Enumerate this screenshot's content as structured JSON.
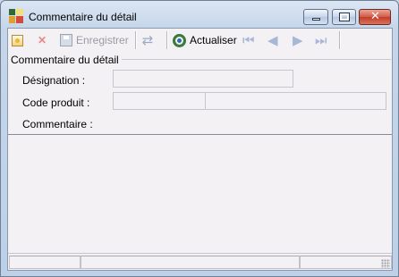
{
  "window": {
    "title": "Commentaire du détail",
    "app_icon": "app-grid-icon",
    "controls": {
      "minimize_icon": "minimize-icon",
      "maximize_icon": "maximize-icon",
      "close_icon": "close-icon"
    }
  },
  "toolbar": {
    "new_icon": "new-record-icon",
    "delete_icon": "delete-icon",
    "save_label": "Enregistrer",
    "save_icon": "save-icon",
    "sync_icon": "sync-icon",
    "refresh_label": "Actualiser",
    "refresh_icon": "refresh-icon",
    "nav_icons": [
      "first-record-icon",
      "previous-record-icon",
      "next-record-icon",
      "last-record-icon"
    ]
  },
  "form": {
    "group_title": "Commentaire du détail",
    "designation_label": "Désignation :",
    "designation_value": "",
    "code_label": "Code produit :",
    "code_value": "",
    "code_description": "",
    "comment_label": "Commentaire :",
    "comment_value": ""
  },
  "statusbar": {
    "panel1": "",
    "panel2": "",
    "panel3": ""
  },
  "colors": {
    "title_gradient_top": "#dbe6f3",
    "client_bg": "#f4f1f4",
    "close_red": "#c33c2a"
  }
}
